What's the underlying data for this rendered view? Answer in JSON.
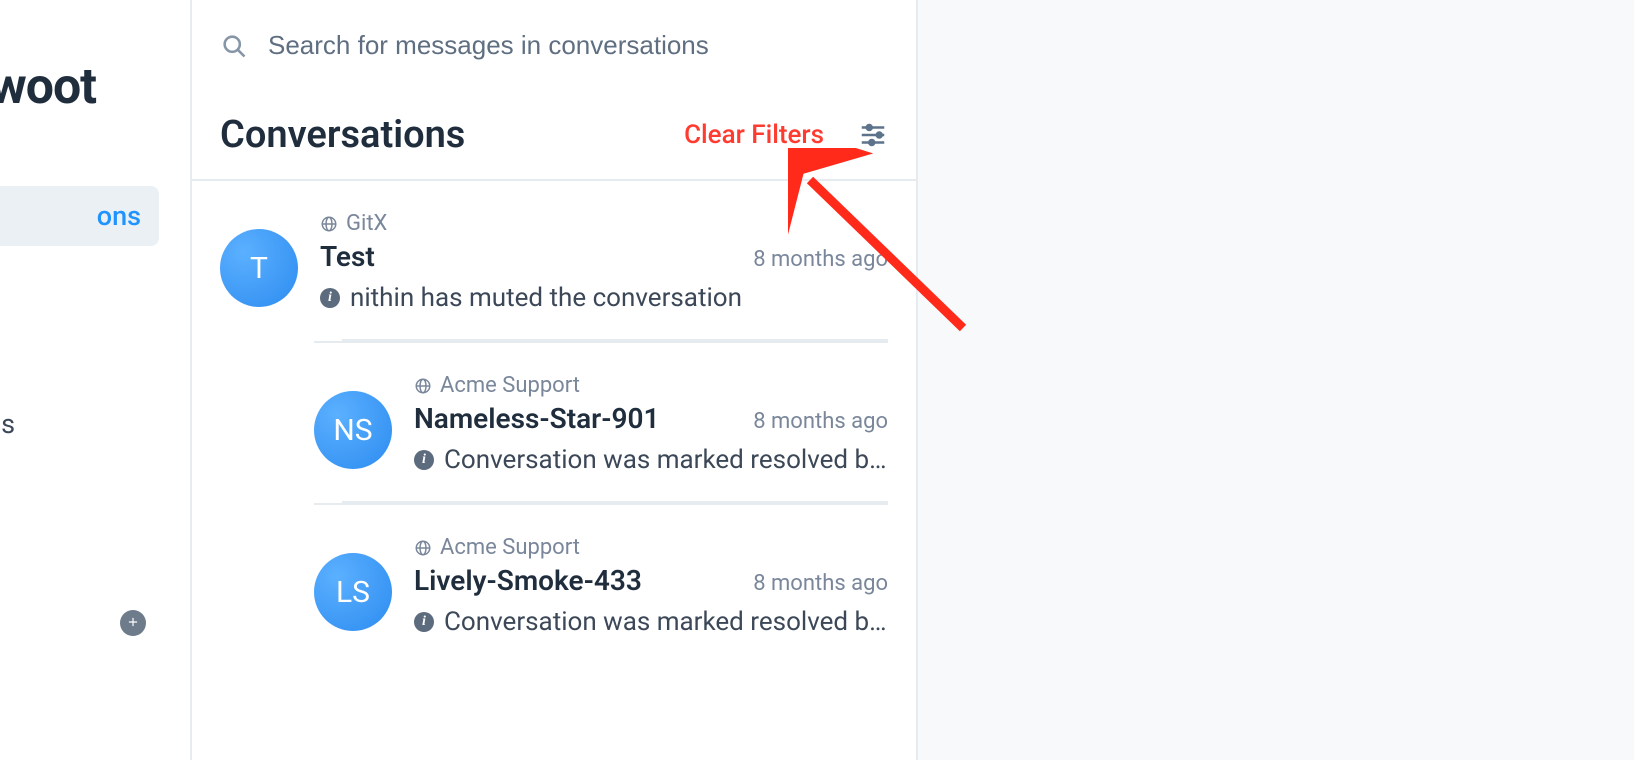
{
  "sidebar": {
    "logo_fragment": "woot",
    "active_nav_fragment": "ons",
    "secondary_nav_fragment": "s"
  },
  "search": {
    "placeholder": "Search for messages in conversations"
  },
  "header": {
    "title": "Conversations",
    "clear_filters_label": "Clear Filters"
  },
  "conversations": [
    {
      "avatar_initials": "T",
      "channel": "GitX",
      "title": "Test",
      "time": "8 months ago",
      "message": "nithin has muted the conversation"
    },
    {
      "avatar_initials": "NS",
      "channel": "Acme Support",
      "title": "Nameless-Star-901",
      "time": "8 months ago",
      "message": "Conversation was marked resolved b..."
    },
    {
      "avatar_initials": "LS",
      "channel": "Acme Support",
      "title": "Lively-Smoke-433",
      "time": "8 months ago",
      "message": "Conversation was marked resolved b..."
    }
  ]
}
